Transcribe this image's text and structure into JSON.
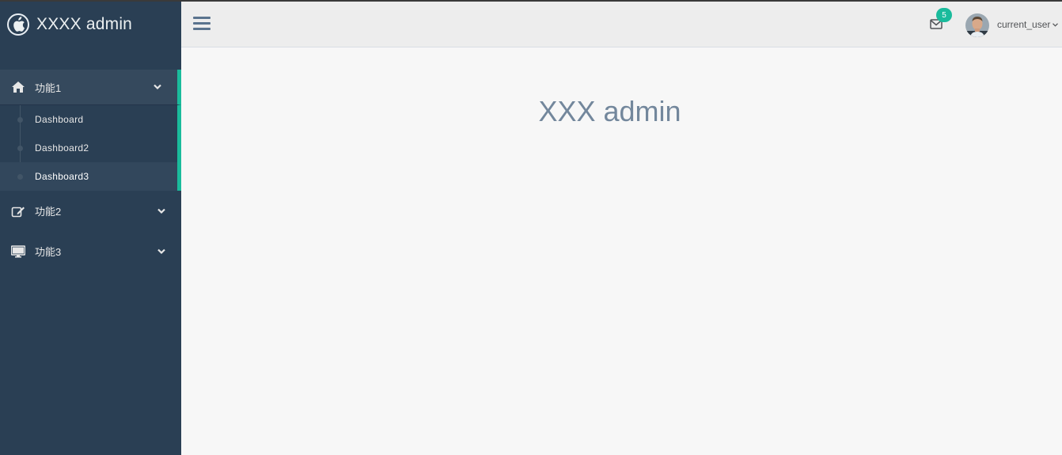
{
  "app": {
    "brand_title": "XXXX admin",
    "brand_icon": "apple-icon"
  },
  "sidebar": {
    "accent_color": "#1abb9c",
    "background_color": "#2a3f54",
    "menu": [
      {
        "label": "功能1",
        "icon": "home-icon",
        "expanded": true,
        "children": [
          {
            "label": "Dashboard"
          },
          {
            "label": "Dashboard2"
          },
          {
            "label": "Dashboard3"
          }
        ]
      },
      {
        "label": "功能2",
        "icon": "edit-icon",
        "expanded": false
      },
      {
        "label": "功能3",
        "icon": "desktop-icon",
        "expanded": false
      }
    ]
  },
  "topbar": {
    "toggle_icon": "menu-icon",
    "mail_icon": "envelope-icon",
    "notification_count": "5",
    "username": "current_user"
  },
  "main": {
    "title": "XXX admin"
  }
}
